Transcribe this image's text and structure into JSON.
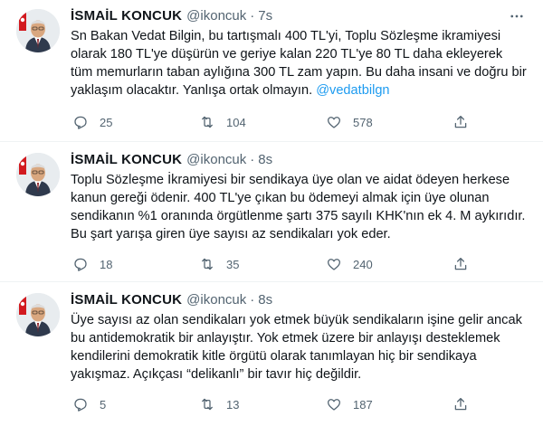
{
  "tweets": [
    {
      "author_name": "İSMAİL KONCUK",
      "handle": "@ikoncuk",
      "separator": "·",
      "time": "7s",
      "text": "Sn Bakan Vedat Bilgin, bu tartışmalı 400 TL'yi, Toplu Sözleşme ikramiyesi olarak 180 TL'ye düşürün ve geriye kalan 220 TL'ye 80 TL daha ekleyerek tüm memurların taban aylığına 300 TL zam yapın. Bu daha insani ve doğru bir yaklaşım olacaktır. Yanlışa ortak olmayın.",
      "mention": "@vedatbilgn",
      "replies": "25",
      "retweets": "104",
      "likes": "578"
    },
    {
      "author_name": "İSMAİL KONCUK",
      "handle": "@ikoncuk",
      "separator": "·",
      "time": "8s",
      "text": "Toplu Sözleşme İkramiyesi bir sendikaya üye olan ve aidat ödeyen herkese kanun gereği ödenir. 400 TL'ye çıkan bu ödemeyi almak için üye olunan sendikanın %1 oranında örgütlenme şartı 375 sayılı KHK'nın ek 4. M aykırıdır. Bu şart yarışa giren üye sayısı az sendikaları yok eder.",
      "mention": "",
      "replies": "18",
      "retweets": "35",
      "likes": "240"
    },
    {
      "author_name": "İSMAİL KONCUK",
      "handle": "@ikoncuk",
      "separator": "·",
      "time": "8s",
      "text": "Üye sayısı az olan sendikaları yok etmek büyük sendikaların işine gelir ancak bu antidemokratik bir anlayıştır. Yok etmek üzere bir anlayışı desteklemek kendilerini demokratik kitle örgütü olarak tanımlayan hiç bir sendikaya yakışmaz. Açıkçası “delikanlı” bir tavır hiç değildir.",
      "mention": "",
      "replies": "5",
      "retweets": "13",
      "likes": "187"
    }
  ],
  "icons": {
    "more": "more-horizontal-icon",
    "reply": "reply-icon",
    "retweet": "retweet-icon",
    "like": "heart-icon",
    "share": "share-icon"
  },
  "colors": {
    "text": "#0f1419",
    "secondary": "#536471",
    "link": "#1d9bf0",
    "divider": "#eff3f4"
  }
}
